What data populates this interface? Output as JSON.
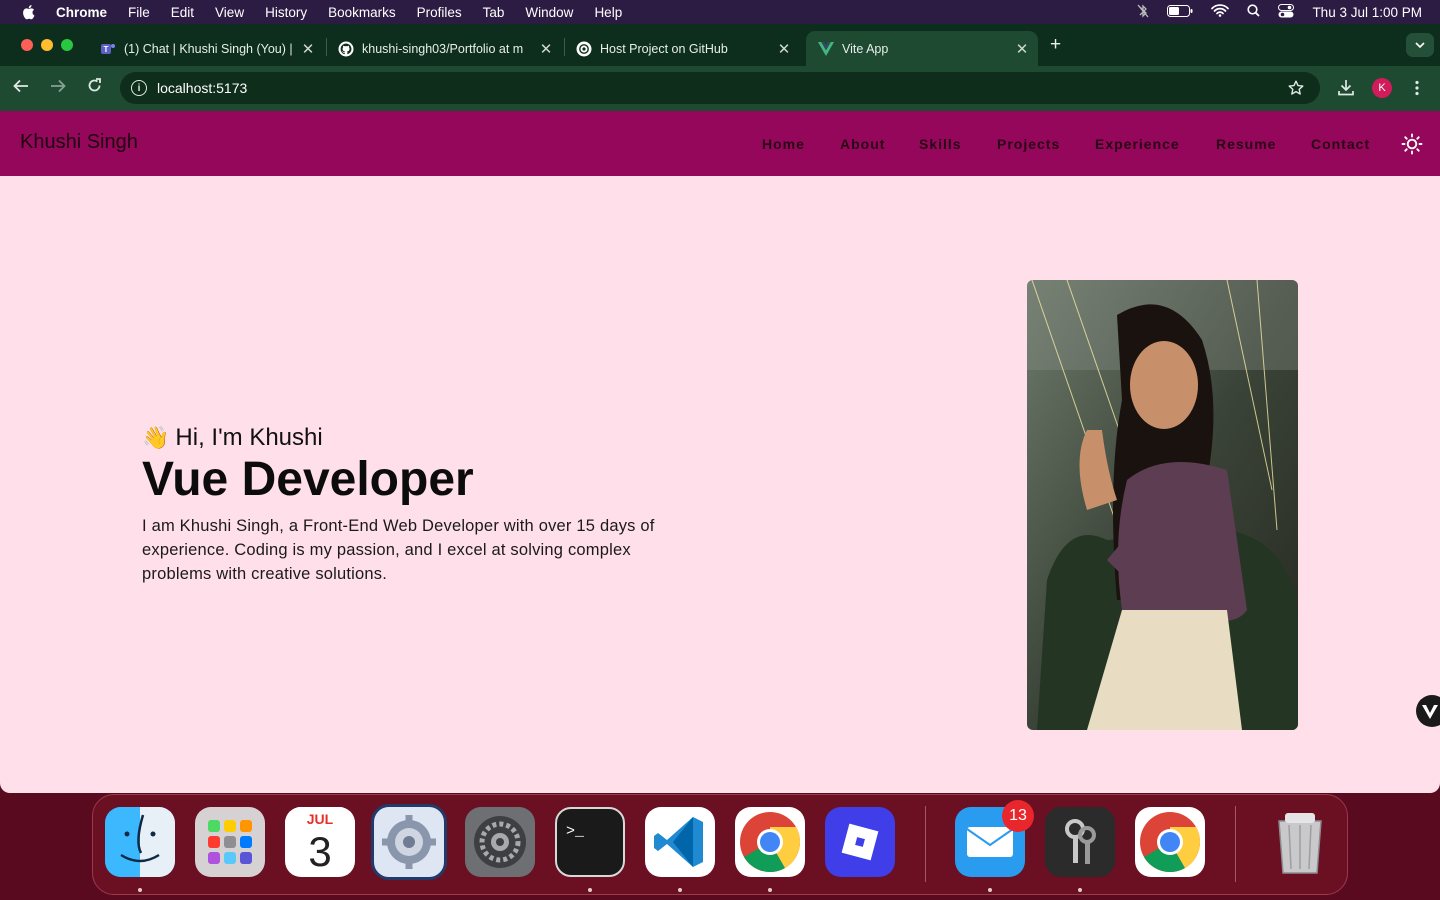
{
  "menubar": {
    "app": "Chrome",
    "items": [
      "File",
      "Edit",
      "View",
      "History",
      "Bookmarks",
      "Profiles",
      "Tab",
      "Window",
      "Help"
    ],
    "datetime": "Thu 3 Jul  1:00 PM"
  },
  "browser": {
    "tabs": [
      {
        "title": "(1) Chat | Khushi Singh (You) |",
        "icon": "teams-icon",
        "active": false
      },
      {
        "title": "khushi-singh03/Portfolio at m",
        "icon": "github-icon",
        "active": false
      },
      {
        "title": "Host Project on GitHub",
        "icon": "openai-icon",
        "active": false
      },
      {
        "title": "Vite App",
        "icon": "vue-icon",
        "active": true
      }
    ],
    "url": "localhost:5173",
    "profile_initial": "K"
  },
  "site": {
    "brand": "Khushi Singh",
    "nav": [
      "Home",
      "About",
      "Skills",
      "Projects",
      "Experience",
      "Resume",
      "Contact"
    ],
    "hero": {
      "wave": "👋",
      "greeting": "Hi, I'm Khushi",
      "title": "Vue Developer",
      "description": "I am Khushi Singh, a Front-End Web Developer with over 15 days of experience. Coding is my passion, and I excel at solving complex problems with creative solutions."
    }
  },
  "dock": {
    "calendar": {
      "month": "JUL",
      "day": "3"
    },
    "mail_badge": "13",
    "apps": [
      "finder-icon",
      "launchpad-icon",
      "calendar-icon",
      "system-preferences-icon",
      "settings-icon",
      "terminal-icon",
      "vscode-icon",
      "chrome-icon",
      "roblox-icon",
      "mail-icon",
      "keychain-icon",
      "chrome-icon",
      "trash-icon"
    ]
  },
  "colors": {
    "nav_bg": "#94075a",
    "page_bg": "#ffe0ea",
    "browser_frame": "#0d2e1c",
    "toolbar": "#1d4a31"
  }
}
